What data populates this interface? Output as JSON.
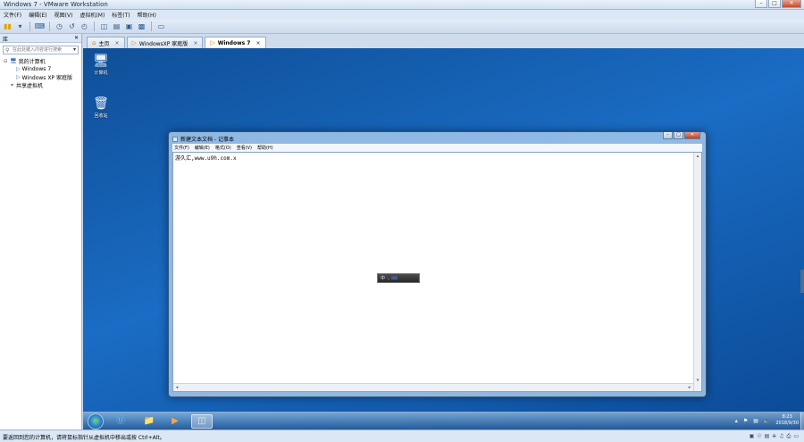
{
  "window": {
    "title": "Windows 7 - VMware Workstation"
  },
  "window_controls": {
    "minimize": "–",
    "maximize": "□",
    "close": "✕"
  },
  "menu": [
    "文件(F)",
    "编辑(E)",
    "视图(V)",
    "虚拟机(M)",
    "标签(T)",
    "帮助(H)"
  ],
  "toolbar": {
    "icons": [
      "power-icon",
      "dropdown-icon",
      "send-keys-icon",
      "snapshot-icon",
      "revert-snapshot-icon",
      "snapshot-manager-icon",
      "sidebar-view-icon",
      "thumbnail-view-icon",
      "full-screen-icon",
      "unity-icon",
      "console-view-icon"
    ]
  },
  "library": {
    "title": "库",
    "close": "✕",
    "search_placeholder": "在此处键入内容进行搜索",
    "items": [
      {
        "label": "我的计算机",
        "level": 0
      },
      {
        "label": "Windows 7",
        "level": 1
      },
      {
        "label": "Windows XP 家庭版",
        "level": 1
      },
      {
        "label": "共享虚拟机",
        "level": 0
      }
    ]
  },
  "tabs": [
    {
      "label": "主页",
      "active": false,
      "close": "×"
    },
    {
      "label": "WindowsXP 家庭版",
      "active": false,
      "close": "×"
    },
    {
      "label": "Windows 7",
      "active": true,
      "close": "×"
    }
  ],
  "desktop": {
    "icons": [
      {
        "label": "计算机",
        "icon": "computer-icon"
      },
      {
        "label": "回收站",
        "icon": "recycle-bin-icon"
      }
    ]
  },
  "notepad": {
    "title": "新建文本文档 - 记事本",
    "menu": [
      "文件(F)",
      "编辑(E)",
      "格式(O)",
      "查看(V)",
      "帮助(H)"
    ],
    "content": "游久汇,www.u9h.com.x"
  },
  "ime": {
    "mode": "中",
    "punct": "ᐧ,",
    "soft_kb": "⌨"
  },
  "taskbar": {
    "items": [
      "ie-icon",
      "explorer-icon",
      "media-player-icon",
      "vmware-tools-icon"
    ],
    "tray_icons": [
      "show-hidden-icon",
      "flag-icon",
      "network-icon",
      "volume-icon"
    ],
    "time": "8:23",
    "date": "2018/9/30"
  },
  "status": {
    "message": "要返回到您的计算机，请将鼠标指针从虚拟机中移出或按 Ctrl+Alt。"
  },
  "devices": [
    "hdd-icon",
    "cd-icon",
    "network-adapter-icon",
    "usb-icon",
    "sound-icon",
    "printer-icon",
    "display-icon"
  ]
}
